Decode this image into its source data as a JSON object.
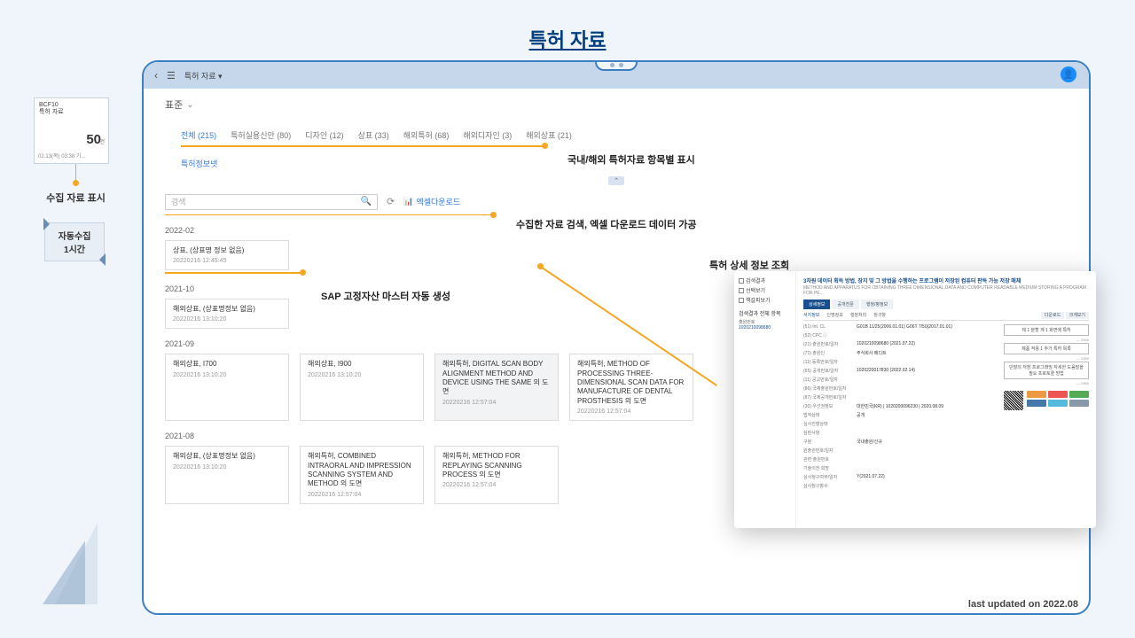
{
  "page_title": "특허 자료",
  "side": {
    "widget": {
      "code": "BCF10",
      "name": "특허 자료",
      "count": "50",
      "unit": "건",
      "time": "02.13(목) 03:38 기..."
    },
    "label": "수집 자료 표시",
    "loop": {
      "l1": "자동수집",
      "l2": "1시간"
    }
  },
  "top": {
    "breadcrumb": "특허 자료",
    "chev": "▾"
  },
  "std": "표준",
  "tabs": [
    {
      "label": "전체 (215)",
      "active": true
    },
    {
      "label": "특허실용신안 (80)"
    },
    {
      "label": "디자인 (12)"
    },
    {
      "label": "상표 (33)"
    },
    {
      "label": "해외특허 (68)"
    },
    {
      "label": "해외디자인 (3)"
    },
    {
      "label": "해외상표 (21)"
    }
  ],
  "sublink": "특허정보넷",
  "search_ph": "검색",
  "excel": "엑셀다운로드",
  "callouts": {
    "c1": "국내/해외 특허자료 항목별 표시",
    "c2": "수집한 자료 검색, 엑셀 다운로드 데이터 가공",
    "c3": "SAP 고정자산 마스터 자동 생성",
    "c4": "특허 상세 정보 조회"
  },
  "months": {
    "m1": "2022-02",
    "m2": "2021-10",
    "m3": "2021-09",
    "m4": "2021-08"
  },
  "cards": {
    "a1": {
      "t": "상표, (상표명 정보 없음)",
      "d": "20220216 12:45:45"
    },
    "b1": {
      "t": "해외상표, (상표명정보 없음)",
      "d": "20220216 13:10:20"
    },
    "c_1": {
      "t": "해외상표, I700",
      "d": "20220216 13:10:20"
    },
    "c_2": {
      "t": "해외상표, I900",
      "d": "20220216 13:10:20"
    },
    "c_3": {
      "t": "해외특허, DIGITAL SCAN BODY ALIGNMENT METHOD AND DEVICE USING THE SAME 의 도면",
      "d": "20220216 12:57:04"
    },
    "c_4": {
      "t": "해외특허, METHOD OF PROCESSING THREE-DIMENSIONAL SCAN DATA FOR MANUFACTURE OF DENTAL PROSTHESIS 의 도면",
      "d": "20220216 12:57:04"
    },
    "d_1": {
      "t": "해외상표, (상표명정보 없음)",
      "d": "20220216 13:10:20"
    },
    "d_2": {
      "t": "해외특허, COMBINED INTRAORAL AND IMPRESSION SCANNING SYSTEM AND METHOD 의 도면",
      "d": "20220216 12:57:04"
    },
    "d_3": {
      "t": "해외특허, METHOD FOR REPLAYING SCANNING PROCESS 의 도면",
      "d": "20220216 12:57:04"
    }
  },
  "detail": {
    "left": {
      "opts": [
        "검색결과",
        "선택보기",
        "책갈피보기"
      ],
      "sect": "검색결과 전체 항목",
      "k1": "출원번호",
      "v1": "1020210098680"
    },
    "title": "3차원 데이터 획득 방법, 장치 및 그 방법을 수행하는 프로그램이 저장된 컴퓨터 판독 가능 저장 매체",
    "sub": "METHOD AND APPARATUS FOR OBTAINING THREE DIMENSIONAL DATA AND COMPUTER READABLE MEDIUM STORING A PROGRAM FOR PE...",
    "tabs": [
      "상세정보",
      "공개전문",
      "행정/평정보"
    ],
    "subtabs": [
      "서지정보",
      "인명정보",
      "행정처리",
      "청구항"
    ],
    "rows": [
      {
        "k": "(51) Int. CL",
        "v": "G01B 11/25(2006.01.01) G06T 7/50(2017.01.01)"
      },
      {
        "k": "(52) CPC ⓘ",
        "v": ""
      },
      {
        "k": "(21) 출원번호/일자",
        "v": "1020210098680 (2021.07.22)"
      },
      {
        "k": "(71) 출원인",
        "v": "주식회사 메디트"
      },
      {
        "k": "(11) 등록번호/일자",
        "v": ""
      },
      {
        "k": "(65) 공개번호/일자",
        "v": "1020220017830 (2022.02.14)"
      },
      {
        "k": "(11) 공고번호/일자",
        "v": ""
      },
      {
        "k": "(86) 국제출원번호/일자",
        "v": ""
      },
      {
        "k": "(87) 국제공개번호/일자",
        "v": ""
      },
      {
        "k": "(30) 우선권정보",
        "v": "대한민국(KR)  |  1020200096230  |  2020.08.09"
      },
      {
        "k": "법적상태",
        "v": "공개"
      },
      {
        "k": "심사진행상태",
        "v": ""
      },
      {
        "k": "심판사항",
        "v": ""
      },
      {
        "k": "구분",
        "v": "국내출원/신규"
      },
      {
        "k": "원출원번호/일자",
        "v": ""
      },
      {
        "k": "관련 출원번호",
        "v": ""
      },
      {
        "k": "기술이전 희망",
        "v": ""
      },
      {
        "k": "심사청구여부/일자",
        "v": "Y(2021.07.22)"
      },
      {
        "k": "심사청구항수",
        "v": ""
      }
    ],
    "sideboxes": [
      "제 1 분할 계 1 화면에 특허",
      "제품 적용 1 추가 특허 목록",
      "단말의 저장 프로그래밍 자세한 도움말을 필요 프로토콜 방법"
    ],
    "dlbtn1": "다운로드",
    "dlbtn2": "크게보기"
  },
  "last_updated": "last updated on 2022.08"
}
